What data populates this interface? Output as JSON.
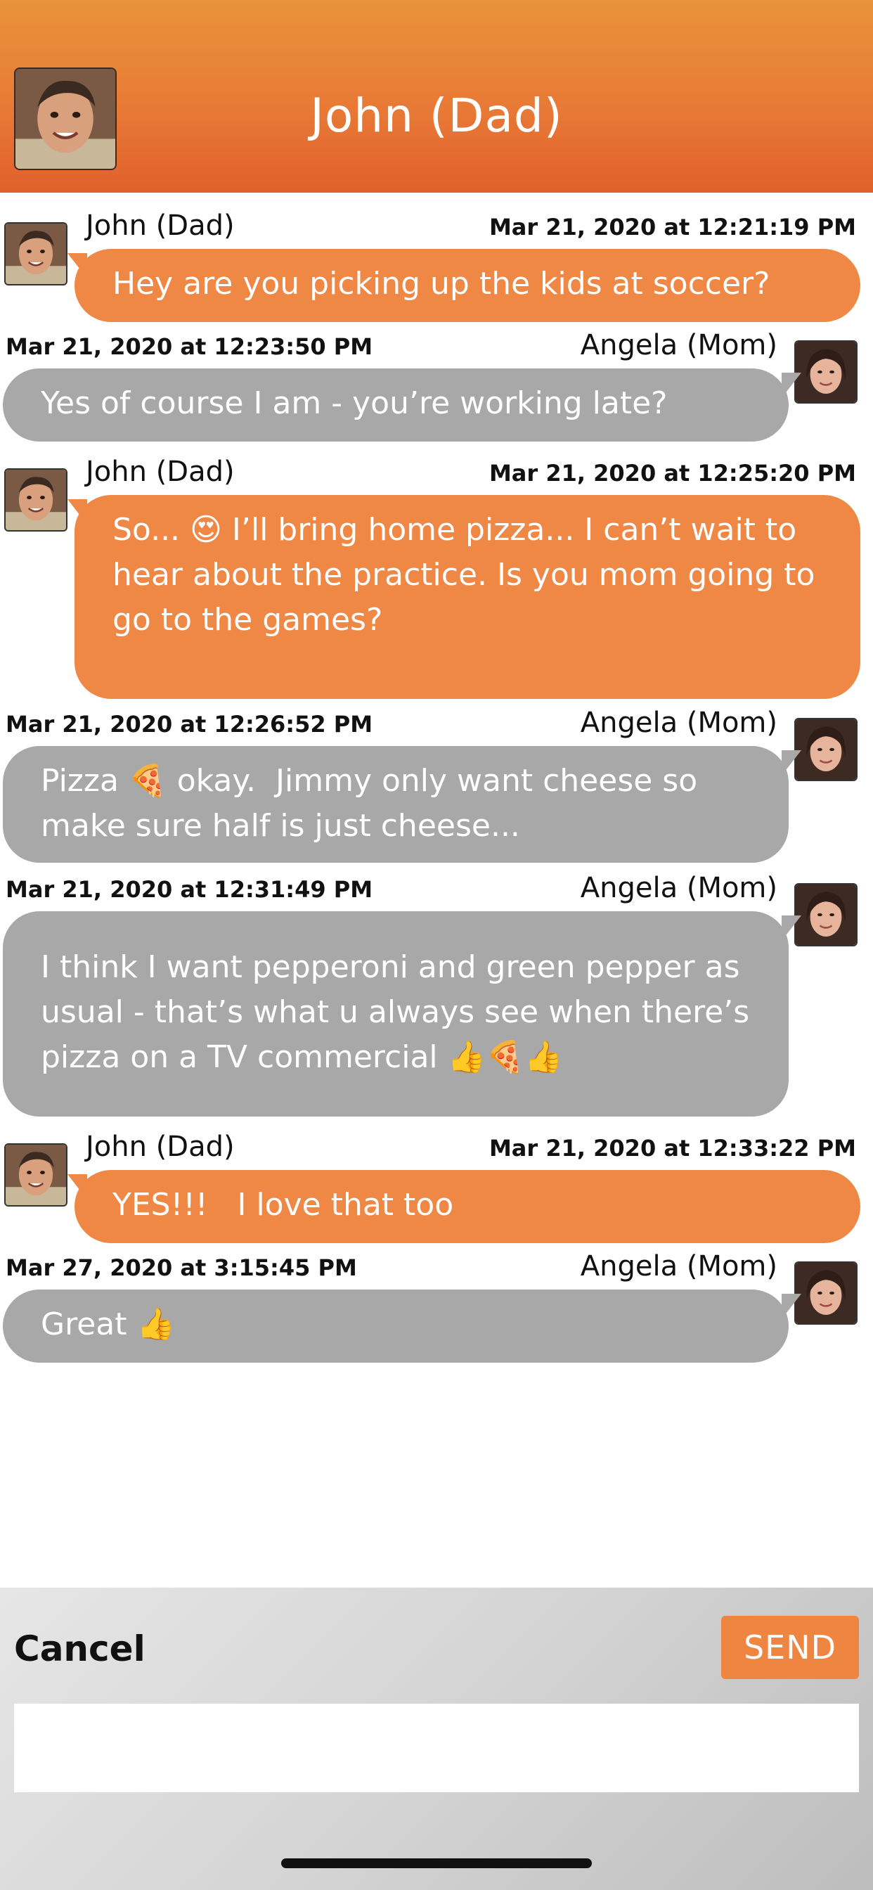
{
  "header": {
    "title": "John (Dad)"
  },
  "messages": [
    {
      "sender": "John (Dad)",
      "time": "Mar 21, 2020 at 12:21:19 PM",
      "text": "Hey are you picking up the kids at soccer?"
    },
    {
      "sender": "Angela (Mom)",
      "time": "Mar 21, 2020 at 12:23:50 PM",
      "text": "Yes of course I am - you’re working late?"
    },
    {
      "sender": "John (Dad)",
      "time": "Mar 21, 2020 at 12:25:20 PM",
      "text": "So... 😍 I’ll bring home pizza... I can’t wait to hear about the practice. Is you mom going to go to the games?"
    },
    {
      "sender": "Angela (Mom)",
      "time": "Mar 21, 2020 at 12:26:52 PM",
      "text": "Pizza 🍕 okay.  Jimmy only want cheese so make sure half is just cheese..."
    },
    {
      "sender": "Angela (Mom)",
      "time": "Mar 21, 2020 at 12:31:49 PM",
      "text": "I think I want pepperoni and green pepper as usual - that’s what u always see when there’s pizza on a TV commercial 👍🍕👍"
    },
    {
      "sender": "John (Dad)",
      "time": "Mar 21, 2020 at 12:33:22 PM",
      "text": "YES!!!   I love that too"
    },
    {
      "sender": "Angela (Mom)",
      "time": "Mar 27, 2020 at 3:15:45 PM",
      "text": "Great 👍"
    }
  ],
  "compose": {
    "cancel_label": "Cancel",
    "send_label": "SEND",
    "input_value": ""
  },
  "colors": {
    "dad_bubble": "#ef8745",
    "mom_bubble": "#a8a8a8",
    "header_orange": "#e87a36"
  }
}
